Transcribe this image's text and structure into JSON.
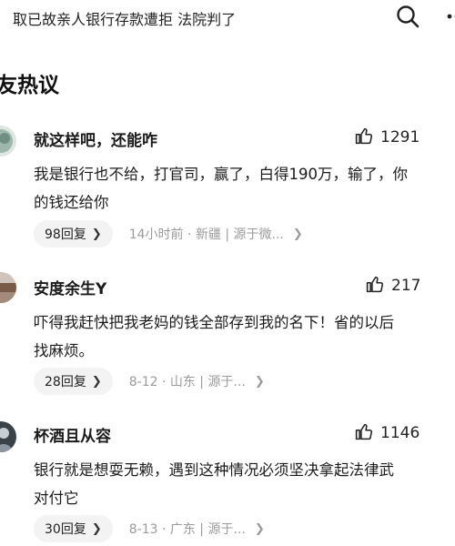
{
  "header": {
    "title": "取已故亲人银行存款遭拒 法院判了"
  },
  "section": {
    "title": "友热议"
  },
  "comments": [
    {
      "author": "就这样吧，还能咋",
      "likes": "1291",
      "lines": [
        "我是银行也不给，打官司，赢了，白得190万，输了，你",
        "的钱还给你"
      ],
      "replies": "98回复",
      "meta": "14小时前 · 新疆 | 源于微...",
      "avatar_color": "#8aa79a"
    },
    {
      "author": "安度余生Y",
      "likes": "217",
      "lines": [
        "吓得我赶快把我老妈的钱全部存到我的名下！省的以后",
        "找麻烦。"
      ],
      "replies": "28回复",
      "meta": "8-12 · 山东 | 源于...",
      "avatar_color": "#7a5a48"
    },
    {
      "author": "杯酒且从容",
      "likes": "1146",
      "lines": [
        "银行就是想耍无赖，遇到这种情况必须坚决拿起法律武",
        "对付它"
      ],
      "replies": "30回复",
      "meta": "8-13 · 广东 | 源于...",
      "avatar_color": "#5f6a72"
    }
  ]
}
